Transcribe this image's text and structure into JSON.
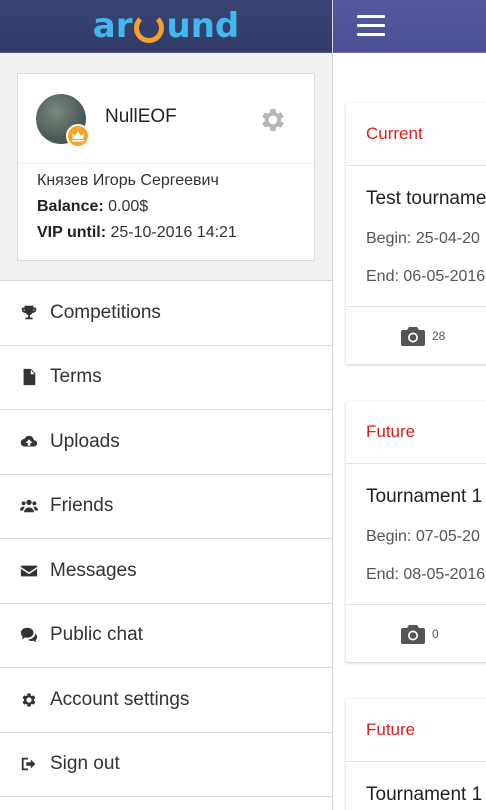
{
  "brand": {
    "logo_left": "ar",
    "logo_right": "und"
  },
  "profile": {
    "username": "NullEOF",
    "full_name": "Князев Игорь Сергеевич",
    "balance_label": "Balance:",
    "balance_value": "0.00$",
    "vip_label": "VIP until:",
    "vip_value": "25-10-2016 14:21"
  },
  "menu": {
    "items": [
      {
        "label": "Competitions",
        "icon": "trophy-icon"
      },
      {
        "label": "Terms",
        "icon": "document-icon"
      },
      {
        "label": "Uploads",
        "icon": "cloud-upload-icon"
      },
      {
        "label": "Friends",
        "icon": "users-icon"
      },
      {
        "label": "Messages",
        "icon": "envelope-icon"
      },
      {
        "label": "Public chat",
        "icon": "chat-icon"
      },
      {
        "label": "Account settings",
        "icon": "gear-icon"
      },
      {
        "label": "Sign out",
        "icon": "sign-out-icon"
      }
    ]
  },
  "tournaments": [
    {
      "status": "Current",
      "name": "Test tourname",
      "begin": "Begin: 25-04-20",
      "end": "End: 06-05-2016",
      "photos": "28"
    },
    {
      "status": "Future",
      "name": "Tournament 1",
      "begin": "Begin: 07-05-20",
      "end": "End: 08-05-2016",
      "photos": "0"
    },
    {
      "status": "Future",
      "name": "Tournament 1"
    }
  ],
  "colors": {
    "header": "#3a4272",
    "topbar": "#4f53968",
    "status": "#e01b1b",
    "logo_blue": "#42b8f0",
    "logo_orange": "#f5a12c"
  }
}
